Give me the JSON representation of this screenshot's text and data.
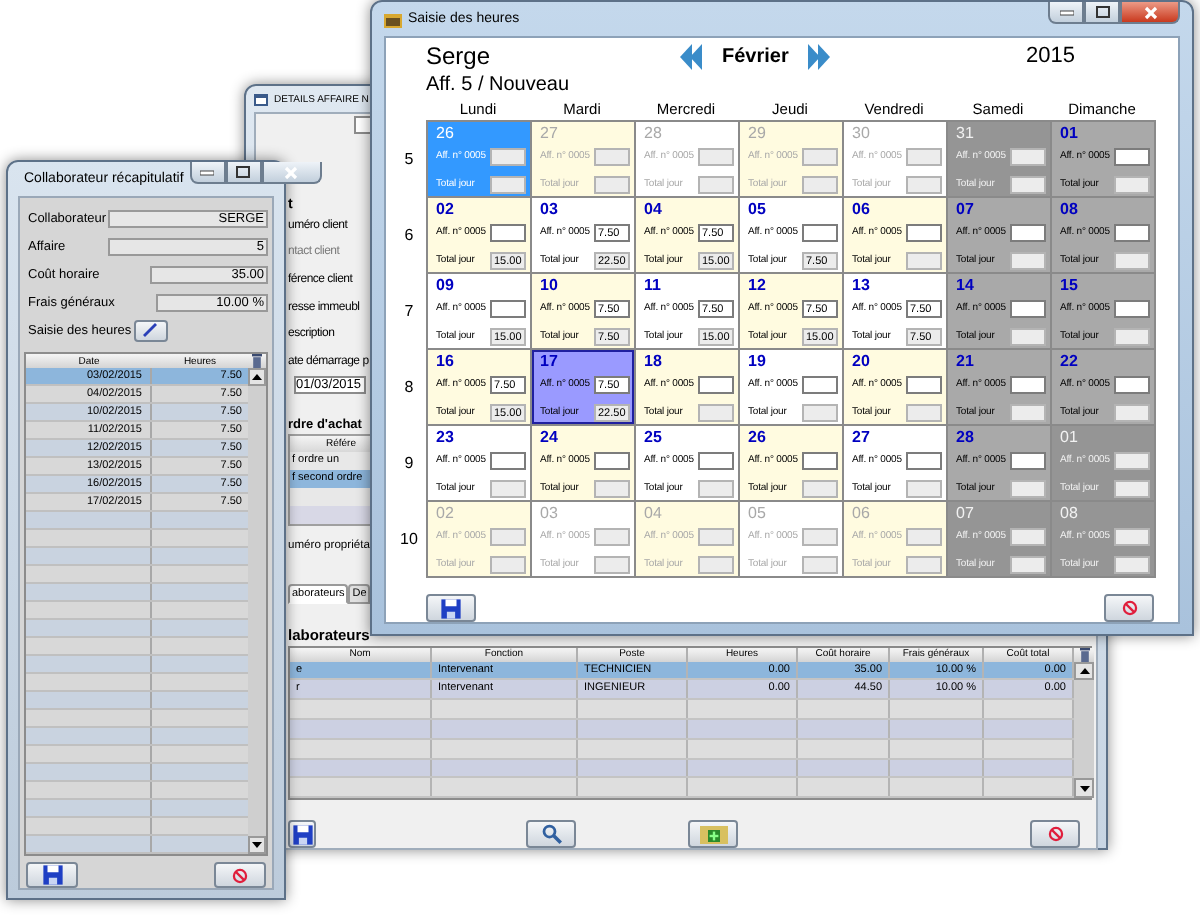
{
  "details_window": {
    "title": "DETAILS AFFAIRE N",
    "labels": [
      {
        "text": "t",
        "kind": "heading"
      },
      {
        "text": "uméro client",
        "kind": "label"
      },
      {
        "text": "ntact client",
        "kind": "muted"
      },
      {
        "text": "férence client",
        "kind": "label"
      },
      {
        "text": "resse immeubl",
        "kind": "label"
      },
      {
        "text": "escription",
        "kind": "label"
      },
      {
        "text": "ate démarrage p",
        "kind": "label"
      }
    ],
    "start_date": "01/03/2015",
    "orders": {
      "heading": "rdre d'achat",
      "column": "Référe",
      "rows": [
        {
          "text": "f ordre un",
          "selected": false
        },
        {
          "text": "f second ordre",
          "selected": true
        }
      ]
    },
    "owner_label": "uméro propriéta",
    "tabs": [
      {
        "label": "aborateurs",
        "selected": true
      },
      {
        "label": "De",
        "selected": false
      }
    ],
    "team_heading": "laborateurs",
    "team": {
      "columns": [
        "Nom",
        "Fonction",
        "Poste",
        "Heures",
        "Coût horaire",
        "Frais généraux",
        "Coût total"
      ],
      "rows": [
        {
          "cells": [
            "e",
            "Intervenant",
            "TECHNICIEN",
            "0.00",
            "35.00",
            "10.00 %",
            "0.00"
          ],
          "selected": true
        },
        {
          "cells": [
            "r",
            "Intervenant",
            "INGENIEUR",
            "0.00",
            "44.50",
            "10.00 %",
            "0.00"
          ],
          "selected": false
        }
      ]
    }
  },
  "recap_window": {
    "title": "Collaborateur récapitulatif",
    "fields": [
      {
        "label": "Collaborateur",
        "value": "SERGE",
        "kind": "long"
      },
      {
        "label": "Affaire",
        "value": "5",
        "kind": "long"
      },
      {
        "label": "Coût horaire",
        "value": "35.00",
        "kind": "short"
      },
      {
        "label": "Frais généraux",
        "value": "10.00 %",
        "kind": "short"
      }
    ],
    "entry_label": "Saisie des heures",
    "table": {
      "columns": [
        "Date",
        "Heures"
      ],
      "rows": [
        {
          "date": "03/02/2015",
          "hours": "7.50",
          "selected": true
        },
        {
          "date": "04/02/2015",
          "hours": "7.50",
          "selected": false
        },
        {
          "date": "10/02/2015",
          "hours": "7.50",
          "selected": false
        },
        {
          "date": "11/02/2015",
          "hours": "7.50",
          "selected": false
        },
        {
          "date": "12/02/2015",
          "hours": "7.50",
          "selected": false
        },
        {
          "date": "13/02/2015",
          "hours": "7.50",
          "selected": false
        },
        {
          "date": "16/02/2015",
          "hours": "7.50",
          "selected": false
        },
        {
          "date": "17/02/2015",
          "hours": "7.50",
          "selected": false
        }
      ]
    }
  },
  "calendar_window": {
    "title": "Saisie des heures",
    "employee": "Serge",
    "month": "Février",
    "year": "2015",
    "project": "Aff. 5 / Nouveau",
    "weekdays": [
      "Lundi",
      "Mardi",
      "Mercredi",
      "Jeudi",
      "Vendredi",
      "Samedi",
      "Dimanche"
    ],
    "weeks": [
      {
        "number": "5",
        "days": [
          {
            "day": "26",
            "hours_label": "Aff. n° 0005",
            "total_label": "Total jour",
            "in_month": false,
            "selected": false,
            "focused": true
          },
          {
            "day": "27",
            "hours_label": "Aff. n° 0005",
            "total_label": "Total jour",
            "in_month": false,
            "selected": false,
            "focused": false
          },
          {
            "day": "28",
            "hours_label": "Aff. n° 0005",
            "total_label": "Total jour",
            "in_month": false,
            "selected": false,
            "focused": false
          },
          {
            "day": "29",
            "hours_label": "Aff. n° 0005",
            "total_label": "Total jour",
            "in_month": false,
            "selected": false,
            "focused": false
          },
          {
            "day": "30",
            "hours_label": "Aff. n° 0005",
            "total_label": "Total jour",
            "in_month": false,
            "selected": false,
            "focused": false
          },
          {
            "day": "31",
            "hours_label": "Aff. n° 0005",
            "total_label": "Total jour",
            "in_month": false,
            "selected": false,
            "focused": false
          },
          {
            "day": "01",
            "hours_label": "Aff. n° 0005",
            "total_label": "Total jour",
            "in_month": true,
            "selected": false,
            "focused": false
          }
        ]
      },
      {
        "number": "6",
        "days": [
          {
            "day": "02",
            "hours_label": "Aff. n° 0005",
            "total_label": "Total jour",
            "total": "15.00",
            "in_month": true,
            "selected": false,
            "focused": false
          },
          {
            "day": "03",
            "hours_label": "Aff. n° 0005",
            "hours": "7.50",
            "total_label": "Total jour",
            "total": "22.50",
            "in_month": true,
            "selected": false,
            "focused": false
          },
          {
            "day": "04",
            "hours_label": "Aff. n° 0005",
            "hours": "7.50",
            "total_label": "Total jour",
            "total": "15.00",
            "in_month": true,
            "selected": false,
            "focused": false
          },
          {
            "day": "05",
            "hours_label": "Aff. n° 0005",
            "total_label": "Total jour",
            "total": "7.50",
            "in_month": true,
            "selected": false,
            "focused": false
          },
          {
            "day": "06",
            "hours_label": "Aff. n° 0005",
            "total_label": "Total jour",
            "in_month": true,
            "selected": false,
            "focused": false
          },
          {
            "day": "07",
            "hours_label": "Aff. n° 0005",
            "total_label": "Total jour",
            "in_month": true,
            "selected": false,
            "focused": false
          },
          {
            "day": "08",
            "hours_label": "Aff. n° 0005",
            "total_label": "Total jour",
            "in_month": true,
            "selected": false,
            "focused": false
          }
        ]
      },
      {
        "number": "7",
        "days": [
          {
            "day": "09",
            "hours_label": "Aff. n° 0005",
            "total_label": "Total jour",
            "total": "15.00",
            "in_month": true,
            "selected": false,
            "focused": false
          },
          {
            "day": "10",
            "hours_label": "Aff. n° 0005",
            "hours": "7.50",
            "total_label": "Total jour",
            "total": "7.50",
            "in_month": true,
            "selected": false,
            "focused": false
          },
          {
            "day": "11",
            "hours_label": "Aff. n° 0005",
            "hours": "7.50",
            "total_label": "Total jour",
            "total": "15.00",
            "in_month": true,
            "selected": false,
            "focused": false
          },
          {
            "day": "12",
            "hours_label": "Aff. n° 0005",
            "hours": "7.50",
            "total_label": "Total jour",
            "total": "15.00",
            "in_month": true,
            "selected": false,
            "focused": false
          },
          {
            "day": "13",
            "hours_label": "Aff. n° 0005",
            "hours": "7.50",
            "total_label": "Total jour",
            "total": "7.50",
            "in_month": true,
            "selected": false,
            "focused": false
          },
          {
            "day": "14",
            "hours_label": "Aff. n° 0005",
            "total_label": "Total jour",
            "in_month": true,
            "selected": false,
            "focused": false
          },
          {
            "day": "15",
            "hours_label": "Aff. n° 0005",
            "total_label": "Total jour",
            "in_month": true,
            "selected": false,
            "focused": false
          }
        ]
      },
      {
        "number": "8",
        "days": [
          {
            "day": "16",
            "hours_label": "Aff. n° 0005",
            "hours": "7.50",
            "total_label": "Total jour",
            "total": "15.00",
            "in_month": true,
            "selected": false,
            "focused": false
          },
          {
            "day": "17",
            "hours_label": "Aff. n° 0005",
            "hours": "7.50",
            "total_label": "Total jour",
            "total": "22.50",
            "in_month": true,
            "selected": true,
            "focused": false
          },
          {
            "day": "18",
            "hours_label": "Aff. n° 0005",
            "total_label": "Total jour",
            "in_month": true,
            "selected": false,
            "focused": false
          },
          {
            "day": "19",
            "hours_label": "Aff. n° 0005",
            "total_label": "Total jour",
            "in_month": true,
            "selected": false,
            "focused": false
          },
          {
            "day": "20",
            "hours_label": "Aff. n° 0005",
            "total_label": "Total jour",
            "in_month": true,
            "selected": false,
            "focused": false
          },
          {
            "day": "21",
            "hours_label": "Aff. n° 0005",
            "total_label": "Total jour",
            "in_month": true,
            "selected": false,
            "focused": false
          },
          {
            "day": "22",
            "hours_label": "Aff. n° 0005",
            "total_label": "Total jour",
            "in_month": true,
            "selected": false,
            "focused": false
          }
        ]
      },
      {
        "number": "9",
        "days": [
          {
            "day": "23",
            "hours_label": "Aff. n° 0005",
            "total_label": "Total jour",
            "in_month": true,
            "selected": false,
            "focused": false
          },
          {
            "day": "24",
            "hours_label": "Aff. n° 0005",
            "total_label": "Total jour",
            "in_month": true,
            "selected": false,
            "focused": false
          },
          {
            "day": "25",
            "hours_label": "Aff. n° 0005",
            "total_label": "Total jour",
            "in_month": true,
            "selected": false,
            "focused": false
          },
          {
            "day": "26",
            "hours_label": "Aff. n° 0005",
            "total_label": "Total jour",
            "in_month": true,
            "selected": false,
            "focused": false
          },
          {
            "day": "27",
            "hours_label": "Aff. n° 0005",
            "total_label": "Total jour",
            "in_month": true,
            "selected": false,
            "focused": false
          },
          {
            "day": "28",
            "hours_label": "Aff. n° 0005",
            "total_label": "Total jour",
            "in_month": true,
            "selected": false,
            "focused": false
          },
          {
            "day": "01",
            "hours_label": "Aff. n° 0005",
            "total_label": "Total jour",
            "in_month": false,
            "selected": false,
            "focused": false
          }
        ]
      },
      {
        "number": "10",
        "days": [
          {
            "day": "02",
            "hours_label": "Aff. n° 0005",
            "total_label": "Total jour",
            "in_month": false,
            "selected": false,
            "focused": false
          },
          {
            "day": "03",
            "hours_label": "Aff. n° 0005",
            "total_label": "Total jour",
            "in_month": false,
            "selected": false,
            "focused": false
          },
          {
            "day": "04",
            "hours_label": "Aff. n° 0005",
            "total_label": "Total jour",
            "in_month": false,
            "selected": false,
            "focused": false
          },
          {
            "day": "05",
            "hours_label": "Aff. n° 0005",
            "total_label": "Total jour",
            "in_month": false,
            "selected": false,
            "focused": false
          },
          {
            "day": "06",
            "hours_label": "Aff. n° 0005",
            "total_label": "Total jour",
            "in_month": false,
            "selected": false,
            "focused": false
          },
          {
            "day": "07",
            "hours_label": "Aff. n° 0005",
            "total_label": "Total jour",
            "in_month": false,
            "selected": false,
            "focused": false
          },
          {
            "day": "08",
            "hours_label": "Aff. n° 0005",
            "total_label": "Total jour",
            "in_month": false,
            "selected": false,
            "focused": false
          }
        ]
      }
    ]
  }
}
